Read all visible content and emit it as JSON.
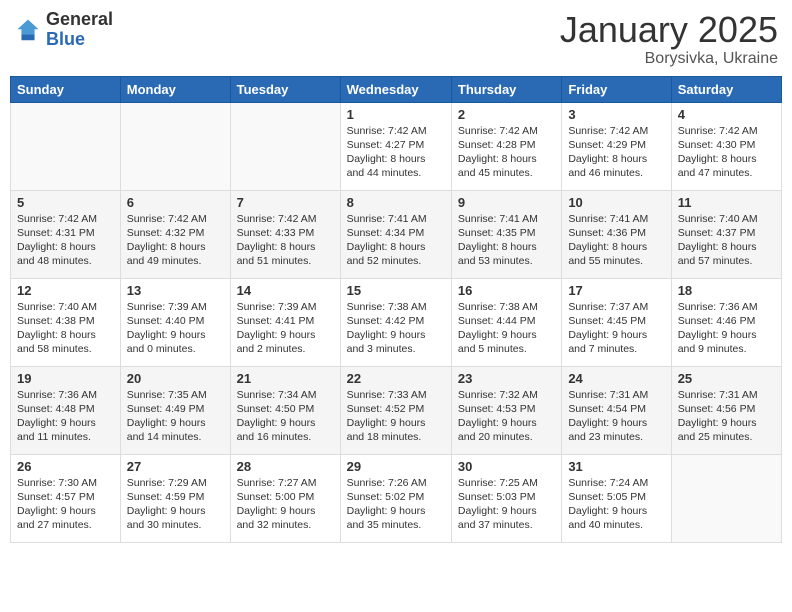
{
  "header": {
    "logo_general": "General",
    "logo_blue": "Blue",
    "month_title": "January 2025",
    "location": "Borysivka, Ukraine"
  },
  "days_of_week": [
    "Sunday",
    "Monday",
    "Tuesday",
    "Wednesday",
    "Thursday",
    "Friday",
    "Saturday"
  ],
  "weeks": [
    [
      {
        "day": "",
        "sunrise": "",
        "sunset": "",
        "daylight": ""
      },
      {
        "day": "",
        "sunrise": "",
        "sunset": "",
        "daylight": ""
      },
      {
        "day": "",
        "sunrise": "",
        "sunset": "",
        "daylight": ""
      },
      {
        "day": "1",
        "sunrise": "Sunrise: 7:42 AM",
        "sunset": "Sunset: 4:27 PM",
        "daylight": "Daylight: 8 hours and 44 minutes."
      },
      {
        "day": "2",
        "sunrise": "Sunrise: 7:42 AM",
        "sunset": "Sunset: 4:28 PM",
        "daylight": "Daylight: 8 hours and 45 minutes."
      },
      {
        "day": "3",
        "sunrise": "Sunrise: 7:42 AM",
        "sunset": "Sunset: 4:29 PM",
        "daylight": "Daylight: 8 hours and 46 minutes."
      },
      {
        "day": "4",
        "sunrise": "Sunrise: 7:42 AM",
        "sunset": "Sunset: 4:30 PM",
        "daylight": "Daylight: 8 hours and 47 minutes."
      }
    ],
    [
      {
        "day": "5",
        "sunrise": "Sunrise: 7:42 AM",
        "sunset": "Sunset: 4:31 PM",
        "daylight": "Daylight: 8 hours and 48 minutes."
      },
      {
        "day": "6",
        "sunrise": "Sunrise: 7:42 AM",
        "sunset": "Sunset: 4:32 PM",
        "daylight": "Daylight: 8 hours and 49 minutes."
      },
      {
        "day": "7",
        "sunrise": "Sunrise: 7:42 AM",
        "sunset": "Sunset: 4:33 PM",
        "daylight": "Daylight: 8 hours and 51 minutes."
      },
      {
        "day": "8",
        "sunrise": "Sunrise: 7:41 AM",
        "sunset": "Sunset: 4:34 PM",
        "daylight": "Daylight: 8 hours and 52 minutes."
      },
      {
        "day": "9",
        "sunrise": "Sunrise: 7:41 AM",
        "sunset": "Sunset: 4:35 PM",
        "daylight": "Daylight: 8 hours and 53 minutes."
      },
      {
        "day": "10",
        "sunrise": "Sunrise: 7:41 AM",
        "sunset": "Sunset: 4:36 PM",
        "daylight": "Daylight: 8 hours and 55 minutes."
      },
      {
        "day": "11",
        "sunrise": "Sunrise: 7:40 AM",
        "sunset": "Sunset: 4:37 PM",
        "daylight": "Daylight: 8 hours and 57 minutes."
      }
    ],
    [
      {
        "day": "12",
        "sunrise": "Sunrise: 7:40 AM",
        "sunset": "Sunset: 4:38 PM",
        "daylight": "Daylight: 8 hours and 58 minutes."
      },
      {
        "day": "13",
        "sunrise": "Sunrise: 7:39 AM",
        "sunset": "Sunset: 4:40 PM",
        "daylight": "Daylight: 9 hours and 0 minutes."
      },
      {
        "day": "14",
        "sunrise": "Sunrise: 7:39 AM",
        "sunset": "Sunset: 4:41 PM",
        "daylight": "Daylight: 9 hours and 2 minutes."
      },
      {
        "day": "15",
        "sunrise": "Sunrise: 7:38 AM",
        "sunset": "Sunset: 4:42 PM",
        "daylight": "Daylight: 9 hours and 3 minutes."
      },
      {
        "day": "16",
        "sunrise": "Sunrise: 7:38 AM",
        "sunset": "Sunset: 4:44 PM",
        "daylight": "Daylight: 9 hours and 5 minutes."
      },
      {
        "day": "17",
        "sunrise": "Sunrise: 7:37 AM",
        "sunset": "Sunset: 4:45 PM",
        "daylight": "Daylight: 9 hours and 7 minutes."
      },
      {
        "day": "18",
        "sunrise": "Sunrise: 7:36 AM",
        "sunset": "Sunset: 4:46 PM",
        "daylight": "Daylight: 9 hours and 9 minutes."
      }
    ],
    [
      {
        "day": "19",
        "sunrise": "Sunrise: 7:36 AM",
        "sunset": "Sunset: 4:48 PM",
        "daylight": "Daylight: 9 hours and 11 minutes."
      },
      {
        "day": "20",
        "sunrise": "Sunrise: 7:35 AM",
        "sunset": "Sunset: 4:49 PM",
        "daylight": "Daylight: 9 hours and 14 minutes."
      },
      {
        "day": "21",
        "sunrise": "Sunrise: 7:34 AM",
        "sunset": "Sunset: 4:50 PM",
        "daylight": "Daylight: 9 hours and 16 minutes."
      },
      {
        "day": "22",
        "sunrise": "Sunrise: 7:33 AM",
        "sunset": "Sunset: 4:52 PM",
        "daylight": "Daylight: 9 hours and 18 minutes."
      },
      {
        "day": "23",
        "sunrise": "Sunrise: 7:32 AM",
        "sunset": "Sunset: 4:53 PM",
        "daylight": "Daylight: 9 hours and 20 minutes."
      },
      {
        "day": "24",
        "sunrise": "Sunrise: 7:31 AM",
        "sunset": "Sunset: 4:54 PM",
        "daylight": "Daylight: 9 hours and 23 minutes."
      },
      {
        "day": "25",
        "sunrise": "Sunrise: 7:31 AM",
        "sunset": "Sunset: 4:56 PM",
        "daylight": "Daylight: 9 hours and 25 minutes."
      }
    ],
    [
      {
        "day": "26",
        "sunrise": "Sunrise: 7:30 AM",
        "sunset": "Sunset: 4:57 PM",
        "daylight": "Daylight: 9 hours and 27 minutes."
      },
      {
        "day": "27",
        "sunrise": "Sunrise: 7:29 AM",
        "sunset": "Sunset: 4:59 PM",
        "daylight": "Daylight: 9 hours and 30 minutes."
      },
      {
        "day": "28",
        "sunrise": "Sunrise: 7:27 AM",
        "sunset": "Sunset: 5:00 PM",
        "daylight": "Daylight: 9 hours and 32 minutes."
      },
      {
        "day": "29",
        "sunrise": "Sunrise: 7:26 AM",
        "sunset": "Sunset: 5:02 PM",
        "daylight": "Daylight: 9 hours and 35 minutes."
      },
      {
        "day": "30",
        "sunrise": "Sunrise: 7:25 AM",
        "sunset": "Sunset: 5:03 PM",
        "daylight": "Daylight: 9 hours and 37 minutes."
      },
      {
        "day": "31",
        "sunrise": "Sunrise: 7:24 AM",
        "sunset": "Sunset: 5:05 PM",
        "daylight": "Daylight: 9 hours and 40 minutes."
      },
      {
        "day": "",
        "sunrise": "",
        "sunset": "",
        "daylight": ""
      }
    ]
  ]
}
